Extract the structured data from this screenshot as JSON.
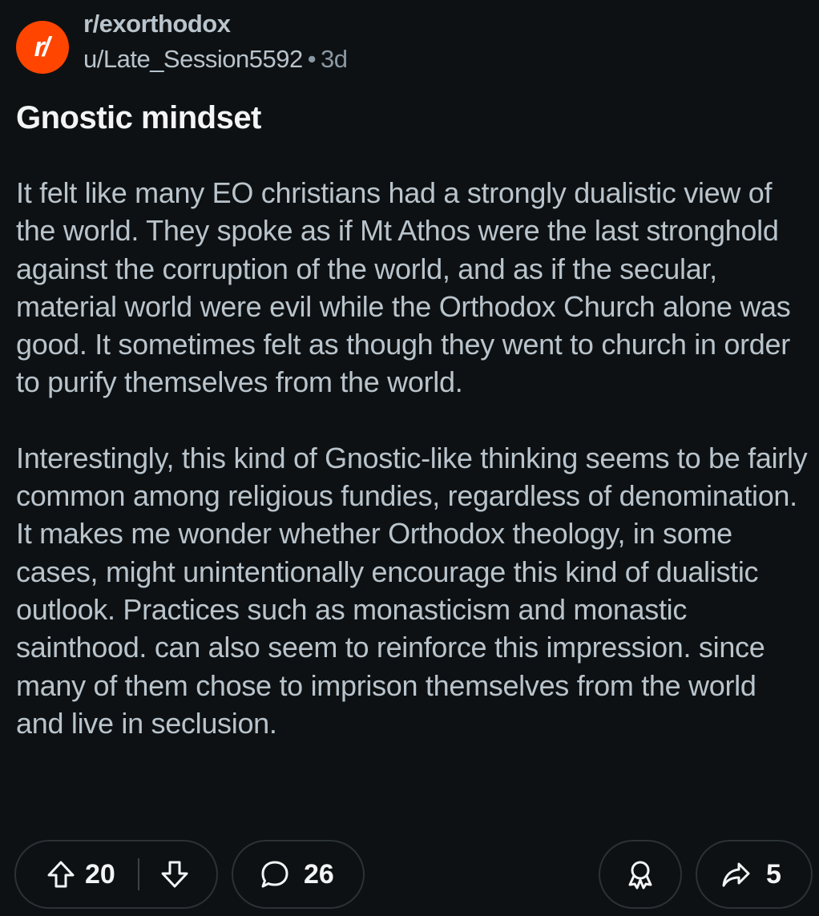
{
  "post": {
    "subreddit": "r/exorthodox",
    "avatar_text": "r/",
    "author": "u/Late_Session5592",
    "separator": "•",
    "age": "3d",
    "title": "Gnostic mindset",
    "paragraphs": [
      "It felt like many EO christians had a strongly dualistic view of the world. They spoke as if Mt Athos were the last stronghold against the corruption of the world, and as if the secular, material world were evil while the Orthodox Church alone was good. It sometimes felt as though they went to church in order to purify themselves from the world.",
      "Interestingly, this kind of Gnostic-like thinking seems to be fairly common among religious fundies, regardless of denomination. It makes me wonder whether Orthodox theology, in some cases, might unintentionally encourage this kind of dualistic outlook. Practices such as monasticism and monastic sainthood. can also seem to reinforce this impression. since many of them chose to imprison themselves from the world and live in seclusion."
    ]
  },
  "actions": {
    "upvote_icon": "arrow-up-outline-icon",
    "downvote_icon": "arrow-down-outline-icon",
    "vote_count": "20",
    "comment_icon": "speech-bubble-icon",
    "comment_count": "26",
    "award_icon": "award-ribbon-icon",
    "share_icon": "share-arrow-icon",
    "share_count": "5"
  },
  "colors": {
    "background": "#0e1113",
    "brand": "#ff4500",
    "text_primary": "#f2f4f5",
    "text_secondary": "#b9c4cc",
    "pill_border": "#2b3236"
  }
}
